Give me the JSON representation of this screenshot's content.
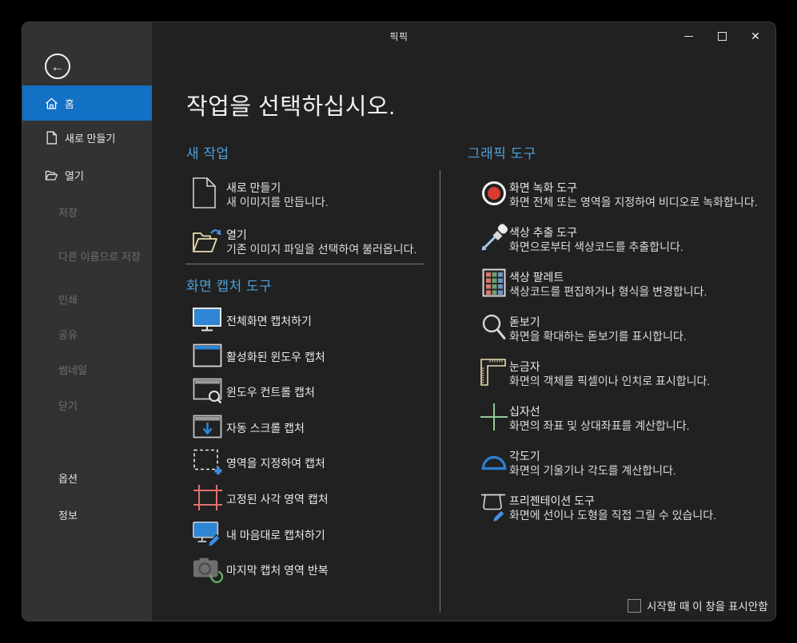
{
  "window": {
    "title": "픽픽",
    "controls": {
      "minimize": "minimize",
      "maximize": "maximize",
      "close": "✕"
    }
  },
  "sidebar": {
    "back_icon": "←",
    "items": [
      {
        "label": "홈",
        "icon": "home-icon",
        "state": "selected"
      },
      {
        "label": "새로 만들기",
        "icon": "new-file-icon",
        "state": "enabled"
      },
      {
        "label": "열기",
        "icon": "open-folder-icon",
        "state": "enabled"
      },
      {
        "label": "저장",
        "state": "disabled"
      },
      {
        "label": "다른 이름으로 저장",
        "state": "disabled"
      },
      {
        "label": "인쇄",
        "state": "disabled"
      },
      {
        "label": "공유",
        "state": "disabled"
      },
      {
        "label": "썸네일",
        "state": "disabled"
      },
      {
        "label": "닫기",
        "state": "disabled"
      }
    ],
    "footer": [
      {
        "label": "옵션"
      },
      {
        "label": "정보"
      }
    ]
  },
  "main": {
    "heading": "작업을 선택하십시오.",
    "new_task": {
      "title": "새 작업",
      "items": [
        {
          "title": "새로 만들기",
          "desc": "새 이미지를 만듭니다.",
          "icon": "new-document-icon"
        },
        {
          "title": "열기",
          "desc": "기존 이미지 파일을 선택하여 불러옵니다.",
          "icon": "open-image-icon"
        }
      ]
    },
    "capture": {
      "title": "화면 캡처 도구",
      "items": [
        {
          "title": "전체화면 캡처하기",
          "icon": "fullscreen-capture-icon"
        },
        {
          "title": "활성화된 윈도우 캡처",
          "icon": "active-window-capture-icon"
        },
        {
          "title": "윈도우 컨트롤 캡처",
          "icon": "window-control-capture-icon"
        },
        {
          "title": "자동 스크롤 캡처",
          "icon": "scrolling-capture-icon"
        },
        {
          "title": "영역을 지정하여 캡처",
          "icon": "region-capture-icon"
        },
        {
          "title": "고정된 사각 영역 캡처",
          "icon": "fixed-region-capture-icon"
        },
        {
          "title": "내 마음대로 캡처하기",
          "icon": "freehand-capture-icon"
        },
        {
          "title": "마지막 캡처 영역 반복",
          "icon": "repeat-last-capture-icon"
        }
      ]
    },
    "graphic": {
      "title": "그래픽 도구",
      "items": [
        {
          "title": "화면 녹화 도구",
          "desc": "화면 전체 또는 영역을 지정하여 비디오로 녹화합니다.",
          "icon": "screen-recorder-icon"
        },
        {
          "title": "색상 추출 도구",
          "desc": "화면으로부터 색상코드를 추출합니다.",
          "icon": "color-picker-icon"
        },
        {
          "title": "색상 팔레트",
          "desc": "색상코드를 편집하거나 형식을 변경합니다.",
          "icon": "color-palette-icon"
        },
        {
          "title": "돋보기",
          "desc": "화면을 확대하는 돋보기를 표시합니다.",
          "icon": "magnifier-icon"
        },
        {
          "title": "눈금자",
          "desc": "화면의 객체를 픽셀이나 인치로 표시합니다.",
          "icon": "ruler-icon"
        },
        {
          "title": "십자선",
          "desc": "화면의 좌표 및 상대좌표를 계산합니다.",
          "icon": "crosshair-icon"
        },
        {
          "title": "각도기",
          "desc": "화면의 기울기나 각도를 계산합니다.",
          "icon": "protractor-icon"
        },
        {
          "title": "프리젠테이션 도구",
          "desc": "화면에 선이나 도형을 직접 그릴 수 있습니다.",
          "icon": "presentation-icon"
        }
      ]
    },
    "startup_checkbox": {
      "label": "시작할 때 이 창을 표시안함",
      "checked": false
    }
  },
  "colors": {
    "accent_blue": "#1271c4",
    "section_title_blue": "#4f9fd9",
    "record_red": "#d93b30",
    "crop_red": "#e4726e",
    "crosshair_green": "#8fca96",
    "protractor_blue": "#2e7fd2",
    "ruler_cream": "#e9dcae",
    "monitor_blue": "#2e86d4",
    "content_bg": "#212121",
    "sidebar_bg": "#323232"
  }
}
